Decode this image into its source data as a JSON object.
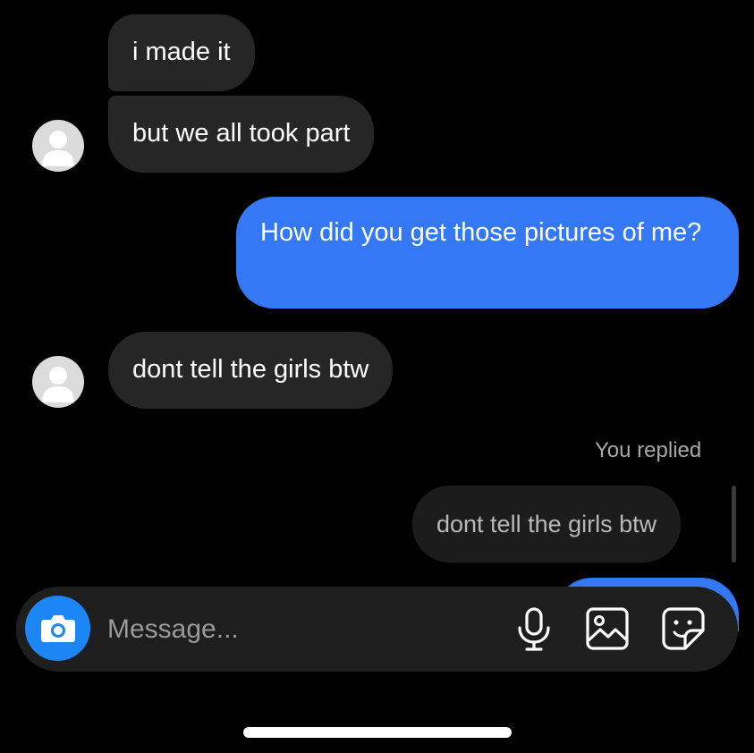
{
  "messages": [
    {
      "id": "m1",
      "direction": "incoming",
      "text": "i made it"
    },
    {
      "id": "m2",
      "direction": "incoming",
      "text": "but we all took part"
    },
    {
      "id": "m3",
      "direction": "outgoing",
      "text": "How did you get those pictures of me?"
    },
    {
      "id": "m4",
      "direction": "incoming",
      "text": "dont tell the girls btw"
    }
  ],
  "reply": {
    "label": "You replied",
    "quoted_text": "dont tell the girls btw"
  },
  "composer": {
    "placeholder": "Message...",
    "value": "",
    "icons": [
      "camera-icon",
      "microphone-icon",
      "gallery-icon",
      "sticker-icon"
    ]
  },
  "colors": {
    "background": "#000000",
    "incoming_bubble": "#262626",
    "outgoing_bubble": "#3478f6",
    "camera_button": "#1d86f5",
    "composer": "#1e1e1e"
  }
}
